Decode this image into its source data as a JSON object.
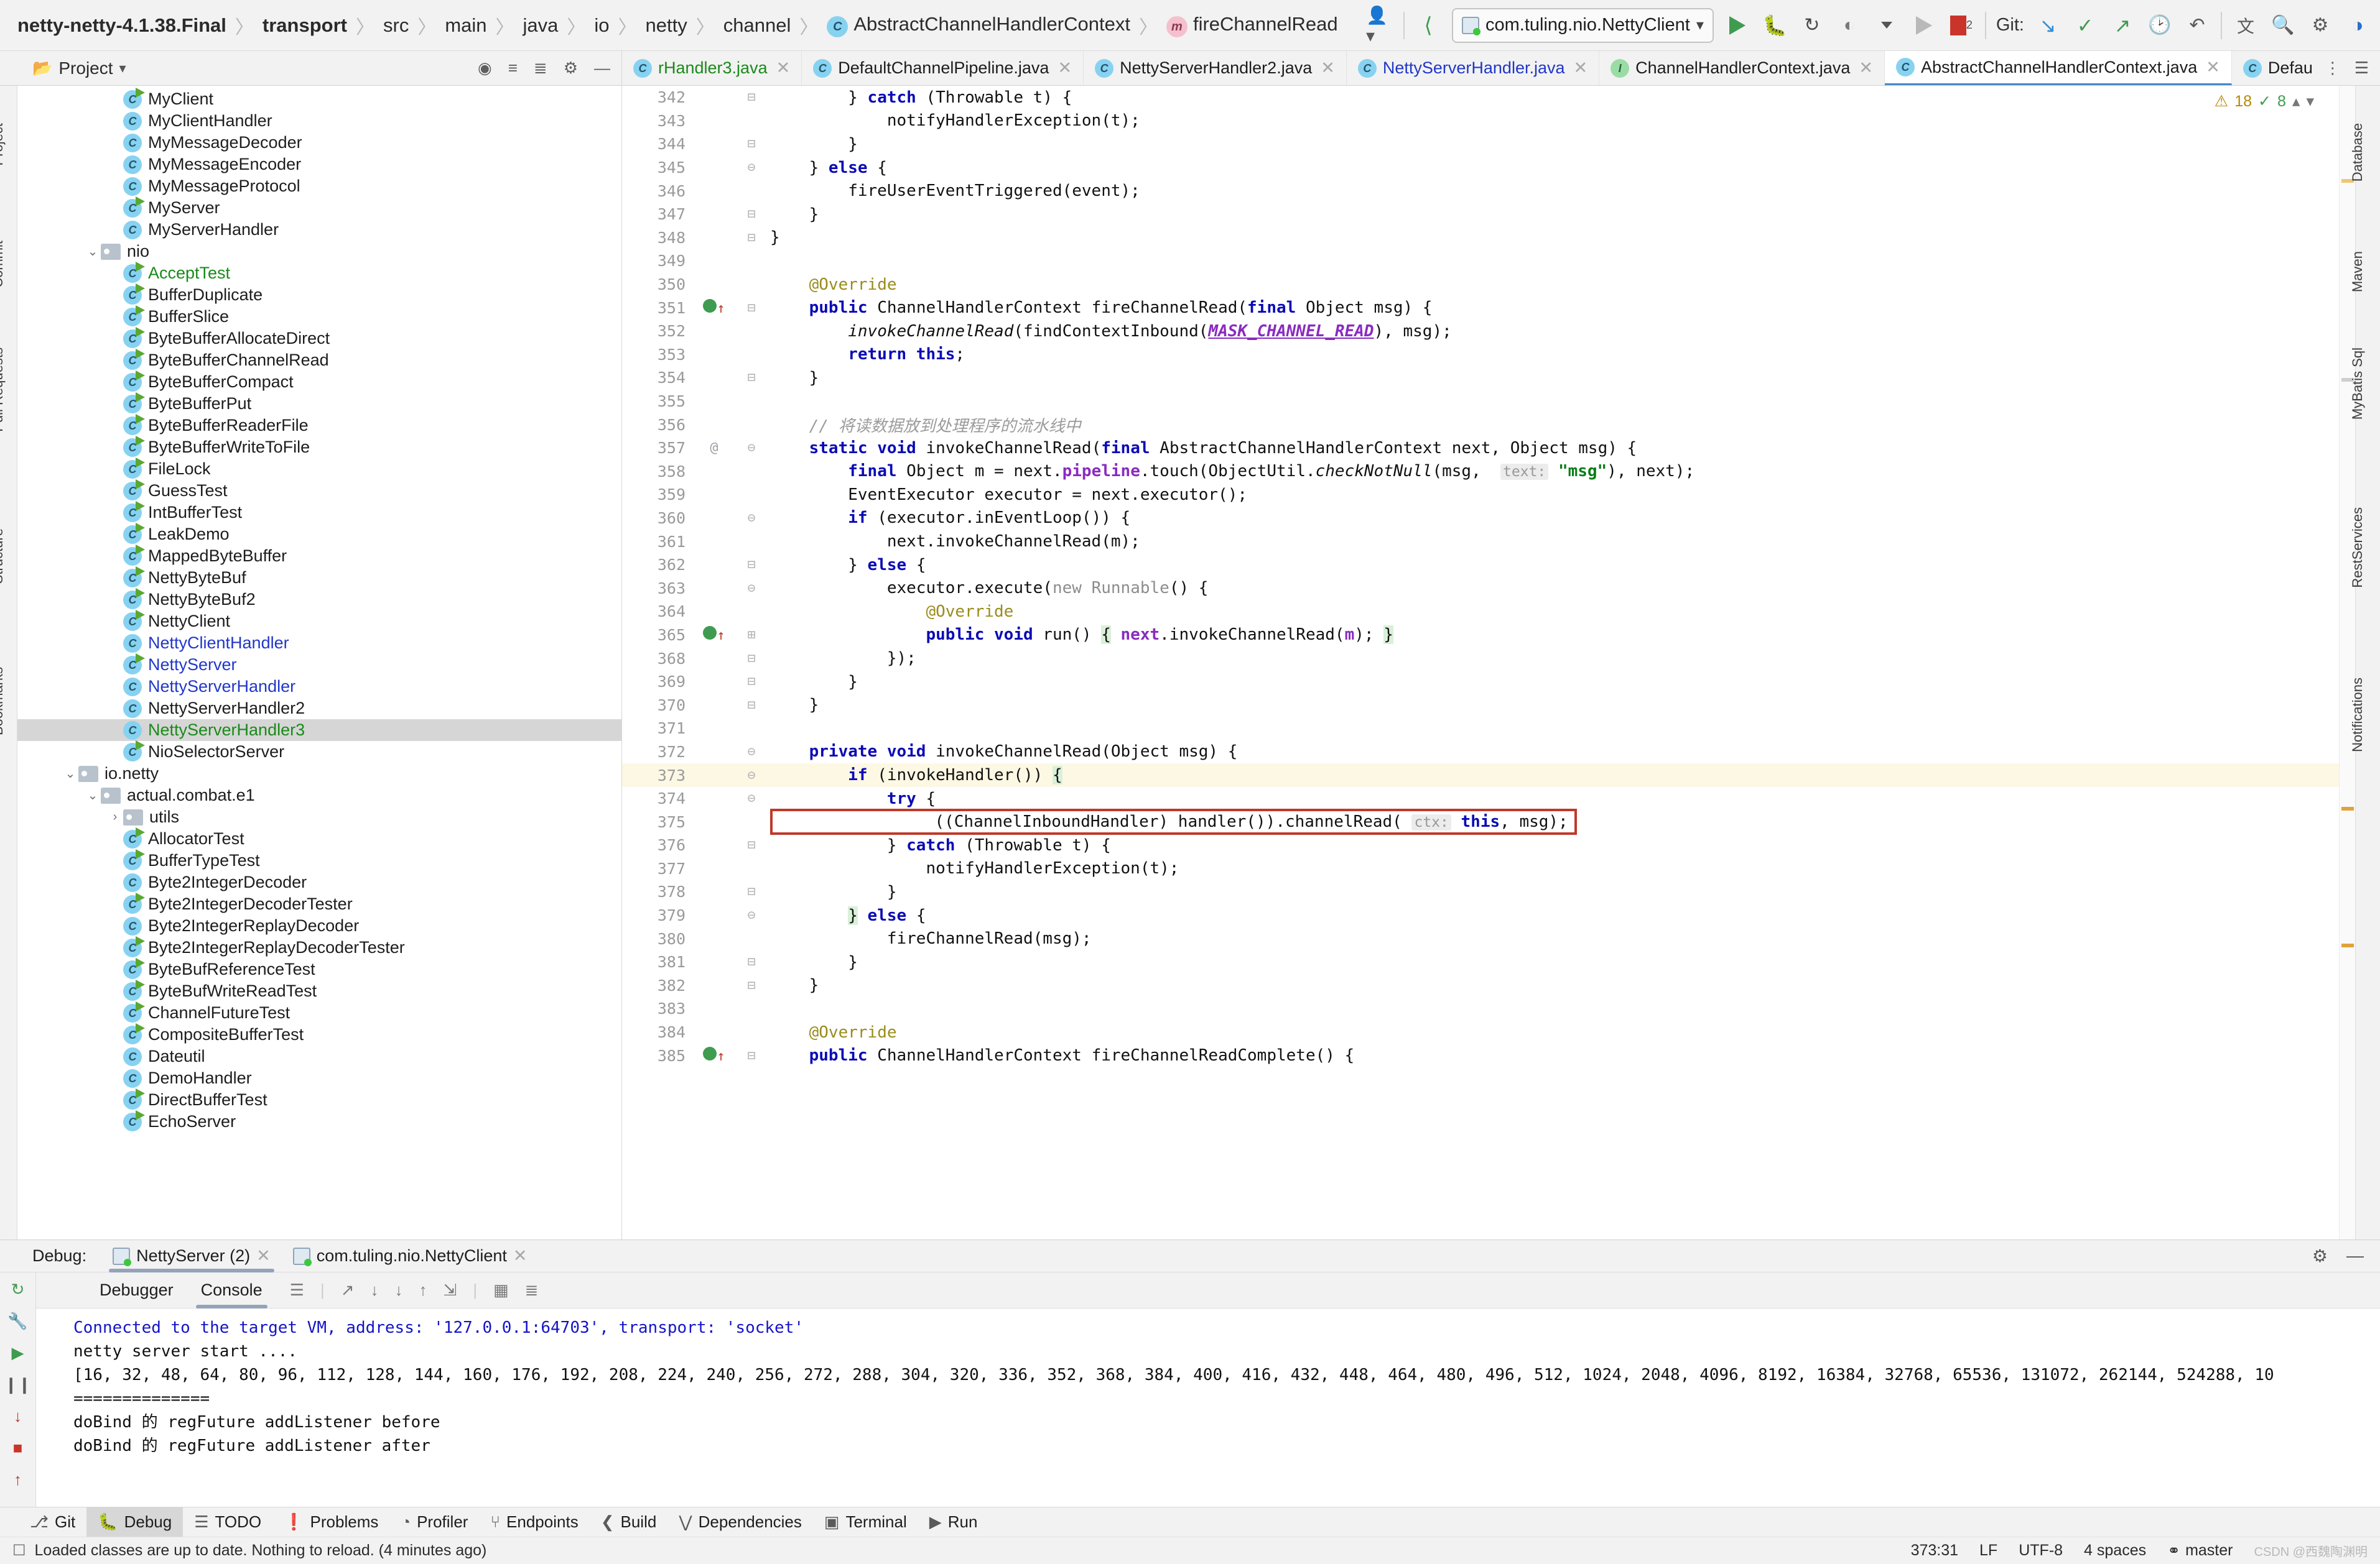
{
  "breadcrumbs": [
    {
      "label": "netty-netty-4.1.38.Final",
      "bold": true,
      "icon": null
    },
    {
      "label": "transport",
      "bold": true,
      "icon": null
    },
    {
      "label": "src",
      "bold": false,
      "icon": null
    },
    {
      "label": "main",
      "bold": false,
      "icon": null
    },
    {
      "label": "java",
      "bold": false,
      "icon": null
    },
    {
      "label": "io",
      "bold": false,
      "icon": null
    },
    {
      "label": "netty",
      "bold": false,
      "icon": null
    },
    {
      "label": "channel",
      "bold": false,
      "icon": null
    },
    {
      "label": "AbstractChannelHandlerContext",
      "bold": false,
      "icon": "class-icon"
    },
    {
      "label": "fireChannelRead",
      "bold": false,
      "icon": "method-icon"
    }
  ],
  "toolbar": {
    "run_config": "com.tuling.nio.NettyClient",
    "git_label": "Git:",
    "error_count": "2",
    "icons": [
      "user-icon",
      "back-arrow-icon",
      "run-icon",
      "debug-icon",
      "rerun-icon",
      "coverage-icon",
      "profile-icon",
      "stop-icon",
      "git-update-icon",
      "git-commit-icon",
      "git-push-icon",
      "history-icon",
      "rollback-icon",
      "translate-icon",
      "search-icon",
      "settings-icon",
      "theme-icon"
    ]
  },
  "project_panel": {
    "title": "Project",
    "icons": [
      "locate-icon",
      "collapse-icon",
      "expand-icon",
      "settings-icon",
      "hide-icon"
    ]
  },
  "editor_tabs": [
    {
      "label": "rHandler3.java",
      "kind": "class",
      "active": false,
      "color": "green"
    },
    {
      "label": "DefaultChannelPipeline.java",
      "kind": "class",
      "active": false,
      "color": "black"
    },
    {
      "label": "NettyServerHandler2.java",
      "kind": "class",
      "active": false,
      "color": "black"
    },
    {
      "label": "NettyServerHandler.java",
      "kind": "class",
      "active": false,
      "color": "blue"
    },
    {
      "label": "ChannelHandlerContext.java",
      "kind": "interface",
      "active": false,
      "color": "black"
    },
    {
      "label": "AbstractChannelHandlerContext.java",
      "kind": "class",
      "active": true,
      "color": "black"
    },
    {
      "label": "DefaultChannelHandlerContext.java",
      "kind": "class",
      "active": false,
      "color": "black"
    }
  ],
  "tree": [
    {
      "depth": 4,
      "label": "MyClient",
      "type": "class",
      "runnable": true,
      "color": "black"
    },
    {
      "depth": 4,
      "label": "MyClientHandler",
      "type": "class",
      "runnable": false,
      "color": "black"
    },
    {
      "depth": 4,
      "label": "MyMessageDecoder",
      "type": "class",
      "runnable": false,
      "color": "black"
    },
    {
      "depth": 4,
      "label": "MyMessageEncoder",
      "type": "class",
      "runnable": false,
      "color": "black"
    },
    {
      "depth": 4,
      "label": "MyMessageProtocol",
      "type": "class",
      "runnable": false,
      "color": "black"
    },
    {
      "depth": 4,
      "label": "MyServer",
      "type": "class",
      "runnable": true,
      "color": "black"
    },
    {
      "depth": 4,
      "label": "MyServerHandler",
      "type": "class",
      "runnable": false,
      "color": "black"
    },
    {
      "depth": 3,
      "label": "nio",
      "type": "folder",
      "expanded": true,
      "color": "black"
    },
    {
      "depth": 4,
      "label": "AcceptTest",
      "type": "class",
      "runnable": true,
      "color": "green"
    },
    {
      "depth": 4,
      "label": "BufferDuplicate",
      "type": "class",
      "runnable": true,
      "color": "black"
    },
    {
      "depth": 4,
      "label": "BufferSlice",
      "type": "class",
      "runnable": true,
      "color": "black"
    },
    {
      "depth": 4,
      "label": "ByteBufferAllocateDirect",
      "type": "class",
      "runnable": true,
      "color": "black"
    },
    {
      "depth": 4,
      "label": "ByteBufferChannelRead",
      "type": "class",
      "runnable": true,
      "color": "black"
    },
    {
      "depth": 4,
      "label": "ByteBufferCompact",
      "type": "class",
      "runnable": true,
      "color": "black"
    },
    {
      "depth": 4,
      "label": "ByteBufferPut",
      "type": "class",
      "runnable": true,
      "color": "black"
    },
    {
      "depth": 4,
      "label": "ByteBufferReaderFile",
      "type": "class",
      "runnable": true,
      "color": "black"
    },
    {
      "depth": 4,
      "label": "ByteBufferWriteToFile",
      "type": "class",
      "runnable": true,
      "color": "black"
    },
    {
      "depth": 4,
      "label": "FileLock",
      "type": "class",
      "runnable": true,
      "color": "black"
    },
    {
      "depth": 4,
      "label": "GuessTest",
      "type": "class",
      "runnable": true,
      "color": "black"
    },
    {
      "depth": 4,
      "label": "IntBufferTest",
      "type": "class",
      "runnable": true,
      "color": "black"
    },
    {
      "depth": 4,
      "label": "LeakDemo",
      "type": "class",
      "runnable": true,
      "color": "black"
    },
    {
      "depth": 4,
      "label": "MappedByteBuffer",
      "type": "class",
      "runnable": true,
      "color": "black"
    },
    {
      "depth": 4,
      "label": "NettyByteBuf",
      "type": "class",
      "runnable": true,
      "color": "black"
    },
    {
      "depth": 4,
      "label": "NettyByteBuf2",
      "type": "class",
      "runnable": true,
      "color": "black"
    },
    {
      "depth": 4,
      "label": "NettyClient",
      "type": "class",
      "runnable": true,
      "color": "black"
    },
    {
      "depth": 4,
      "label": "NettyClientHandler",
      "type": "class",
      "runnable": false,
      "color": "blue"
    },
    {
      "depth": 4,
      "label": "NettyServer",
      "type": "class",
      "runnable": true,
      "color": "blue"
    },
    {
      "depth": 4,
      "label": "NettyServerHandler",
      "type": "class",
      "runnable": false,
      "color": "blue"
    },
    {
      "depth": 4,
      "label": "NettyServerHandler2",
      "type": "class",
      "runnable": false,
      "color": "black"
    },
    {
      "depth": 4,
      "label": "NettyServerHandler3",
      "type": "class",
      "runnable": false,
      "color": "green",
      "selected": true
    },
    {
      "depth": 4,
      "label": "NioSelectorServer",
      "type": "class",
      "runnable": true,
      "color": "black"
    },
    {
      "depth": 2,
      "label": "io.netty",
      "type": "folder",
      "expanded": true,
      "color": "black"
    },
    {
      "depth": 3,
      "label": "actual.combat.e1",
      "type": "folder",
      "expanded": true,
      "color": "black"
    },
    {
      "depth": 4,
      "label": "utils",
      "type": "folder",
      "expanded": false,
      "color": "black"
    },
    {
      "depth": 4,
      "label": "AllocatorTest",
      "type": "class",
      "runnable": true,
      "color": "black"
    },
    {
      "depth": 4,
      "label": "BufferTypeTest",
      "type": "class",
      "runnable": true,
      "color": "black"
    },
    {
      "depth": 4,
      "label": "Byte2IntegerDecoder",
      "type": "class",
      "runnable": false,
      "color": "black"
    },
    {
      "depth": 4,
      "label": "Byte2IntegerDecoderTester",
      "type": "class",
      "runnable": true,
      "color": "black"
    },
    {
      "depth": 4,
      "label": "Byte2IntegerReplayDecoder",
      "type": "class",
      "runnable": false,
      "color": "black"
    },
    {
      "depth": 4,
      "label": "Byte2IntegerReplayDecoderTester",
      "type": "class",
      "runnable": true,
      "color": "black"
    },
    {
      "depth": 4,
      "label": "ByteBufReferenceTest",
      "type": "class",
      "runnable": true,
      "color": "black"
    },
    {
      "depth": 4,
      "label": "ByteBufWriteReadTest",
      "type": "class",
      "runnable": true,
      "color": "black"
    },
    {
      "depth": 4,
      "label": "ChannelFutureTest",
      "type": "class",
      "runnable": true,
      "color": "black"
    },
    {
      "depth": 4,
      "label": "CompositeBufferTest",
      "type": "class",
      "runnable": true,
      "color": "black"
    },
    {
      "depth": 4,
      "label": "Dateutil",
      "type": "class",
      "runnable": false,
      "color": "black"
    },
    {
      "depth": 4,
      "label": "DemoHandler",
      "type": "class",
      "runnable": false,
      "color": "black"
    },
    {
      "depth": 4,
      "label": "DirectBufferTest",
      "type": "class",
      "runnable": true,
      "color": "black"
    },
    {
      "depth": 4,
      "label": "EchoServer",
      "type": "class",
      "runnable": true,
      "color": "black"
    }
  ],
  "inspections": {
    "warnings": "18",
    "oks": "8"
  },
  "code_lines": [
    {
      "no": "342",
      "fold": "-",
      "html": "        } <span class=\"kw\">catch</span> (Throwable t) {"
    },
    {
      "no": "343",
      "fold": "",
      "html": "            notifyHandlerException(t);"
    },
    {
      "no": "344",
      "fold": "-",
      "html": "        }"
    },
    {
      "no": "345",
      "fold": "v",
      "html": "    } <span class=\"kw\">else</span> {"
    },
    {
      "no": "346",
      "fold": "",
      "html": "        fireUserEventTriggered(event);"
    },
    {
      "no": "347",
      "fold": "-",
      "html": "    }"
    },
    {
      "no": "348",
      "fold": "-",
      "html": "}"
    },
    {
      "no": "349",
      "fold": "",
      "html": ""
    },
    {
      "no": "350",
      "fold": "",
      "html": "    <span class=\"an\">@Override</span>"
    },
    {
      "no": "351",
      "fold": "-",
      "bp": true,
      "html": "    <span class=\"kw\">public</span> ChannelHandlerContext fireChannelRead(<span class=\"kw\">final</span> Object msg) {"
    },
    {
      "no": "352",
      "fold": "",
      "html": "        <span class=\"ital\">invokeChannelRead</span>(findContextInbound(<span class=\"stat\">MASK_CHANNEL_READ</span>), msg);"
    },
    {
      "no": "353",
      "fold": "",
      "html": "        <span class=\"kw\">return this</span>;"
    },
    {
      "no": "354",
      "fold": "-",
      "html": "    }"
    },
    {
      "no": "355",
      "fold": "",
      "html": ""
    },
    {
      "no": "356",
      "fold": "",
      "html": "    <span class=\"cm\">// 将读数据放到处理程序的流水线中</span>"
    },
    {
      "no": "357",
      "fold": "v",
      "at": true,
      "html": "    <span class=\"kw\">static void</span> invokeChannelRead(<span class=\"kw\">final</span> AbstractChannelHandlerContext next, Object msg) {"
    },
    {
      "no": "358",
      "fold": "",
      "html": "        <span class=\"kw\">final</span> Object m = next.<span class=\"fld\">pipeline</span>.touch(ObjectUtil.<span class=\"ital\">checkNotNull</span>(msg,  <span class=\"hint\">text:</span> <span class=\"st\">\"msg\"</span>), next);"
    },
    {
      "no": "359",
      "fold": "",
      "html": "        EventExecutor executor = next.executor();"
    },
    {
      "no": "360",
      "fold": "v",
      "html": "        <span class=\"kw\">if</span> (executor.inEventLoop()) {"
    },
    {
      "no": "361",
      "fold": "",
      "html": "            next.invokeChannelRead(m);"
    },
    {
      "no": "362",
      "fold": "-",
      "html": "        } <span class=\"kw\">else</span> {"
    },
    {
      "no": "363",
      "fold": "v",
      "html": "            executor.execute(<span class=\"dim\">new</span> <span class=\"dim\">Runnable</span>() {"
    },
    {
      "no": "364",
      "fold": "",
      "html": "                <span class=\"an\">@Override</span>"
    },
    {
      "no": "365",
      "fold": "+",
      "bp": true,
      "html": "                <span class=\"kw\">public void</span> run() <span class=\"greenbg\">{</span> <span class=\"fld\">next</span>.invokeChannelRead(<span class=\"fld\">m</span>); <span class=\"greenbg\">}</span>"
    },
    {
      "no": "368",
      "fold": "-",
      "html": "            });"
    },
    {
      "no": "369",
      "fold": "-",
      "html": "        }"
    },
    {
      "no": "370",
      "fold": "-",
      "html": "    }"
    },
    {
      "no": "371",
      "fold": "",
      "html": ""
    },
    {
      "no": "372",
      "fold": "v",
      "html": "    <span class=\"kw\">private void</span> invokeChannelRead(Object msg) {"
    },
    {
      "no": "373",
      "fold": "v",
      "hl": true,
      "html": "        <span class=\"kw\">if</span> (invokeHandler()) <span class=\"greenbg\">{</span>"
    },
    {
      "no": "374",
      "fold": "v",
      "html": "            <span class=\"kw\">try</span> {"
    },
    {
      "no": "375",
      "fold": "",
      "boxed": true,
      "html": "                ((ChannelInboundHandler) handler()).channelRead( <span class=\"hint\">ctx:</span> <span class=\"kw\">this</span>, msg);"
    },
    {
      "no": "376",
      "fold": "-",
      "html": "            } <span class=\"kw\">catch</span> (Throwable t) {"
    },
    {
      "no": "377",
      "fold": "",
      "html": "                notifyHandlerException(t);"
    },
    {
      "no": "378",
      "fold": "-",
      "html": "            }"
    },
    {
      "no": "379",
      "fold": "v",
      "html": "        <span class=\"greenbg\">}</span> <span class=\"kw\">else</span> {"
    },
    {
      "no": "380",
      "fold": "",
      "html": "            fireChannelRead(msg);"
    },
    {
      "no": "381",
      "fold": "-",
      "html": "        }"
    },
    {
      "no": "382",
      "fold": "-",
      "html": "    }"
    },
    {
      "no": "383",
      "fold": "",
      "html": ""
    },
    {
      "no": "384",
      "fold": "",
      "html": "    <span class=\"an\">@Override</span>"
    },
    {
      "no": "385",
      "fold": "-",
      "bp": true,
      "html": "    <span class=\"kw\">public</span> ChannelHandlerContext fireChannelReadComplete() {"
    }
  ],
  "debug": {
    "label": "Debug:",
    "sessions": [
      {
        "label": "NettyServer (2)",
        "active": true
      },
      {
        "label": "com.tuling.nio.NettyClient",
        "active": false
      }
    ],
    "subtabs": [
      {
        "label": "Debugger",
        "active": false
      },
      {
        "label": "Console",
        "active": true
      }
    ],
    "console_lines": [
      {
        "text": "Connected to the target VM, address: '127.0.0.1:64703', transport: 'socket'",
        "color": "blue"
      },
      {
        "text": "netty server start ....",
        "color": "black"
      },
      {
        "text": "[16, 32, 48, 64, 80, 96, 112, 128, 144, 160, 176, 192, 208, 224, 240, 256, 272, 288, 304, 320, 336, 352, 368, 384, 400, 416, 432, 448, 464, 480, 496, 512, 1024, 2048, 4096, 8192, 16384, 32768, 65536, 131072, 262144, 524288, 10",
        "color": "black"
      },
      {
        "text": "==============",
        "color": "black"
      },
      {
        "text": "doBind 的 regFuture addListener before",
        "color": "black"
      },
      {
        "text": "doBind 的 regFuture addListener after",
        "color": "black"
      }
    ]
  },
  "tool_window_bar": [
    {
      "label": "Git",
      "icon": "git-icon",
      "active": false
    },
    {
      "label": "Debug",
      "icon": "debug-icon",
      "active": true
    },
    {
      "label": "TODO",
      "icon": "todo-icon",
      "active": false
    },
    {
      "label": "Problems",
      "icon": "problems-icon",
      "active": false
    },
    {
      "label": "Profiler",
      "icon": "profiler-icon",
      "active": false
    },
    {
      "label": "Endpoints",
      "icon": "endpoints-icon",
      "active": false
    },
    {
      "label": "Build",
      "icon": "build-icon",
      "active": false
    },
    {
      "label": "Dependencies",
      "icon": "dependencies-icon",
      "active": false
    },
    {
      "label": "Terminal",
      "icon": "terminal-icon",
      "active": false
    },
    {
      "label": "Run",
      "icon": "run-icon",
      "active": false
    }
  ],
  "status_bar": {
    "message": "Loaded classes are up to date. Nothing to reload. (4 minutes ago)",
    "caret": "373:31",
    "line_sep": "LF",
    "encoding": "UTF-8",
    "indent": "4 spaces",
    "branch": "master",
    "watermark": "CSDN @西魏陶渊明"
  },
  "left_rail": [
    "Project",
    "Commit",
    "Pull Requests",
    "Structure",
    "Bookmarks"
  ],
  "right_rail": [
    "Database",
    "Maven",
    "MyBatis Sql",
    "RestServices",
    "Notifications"
  ]
}
